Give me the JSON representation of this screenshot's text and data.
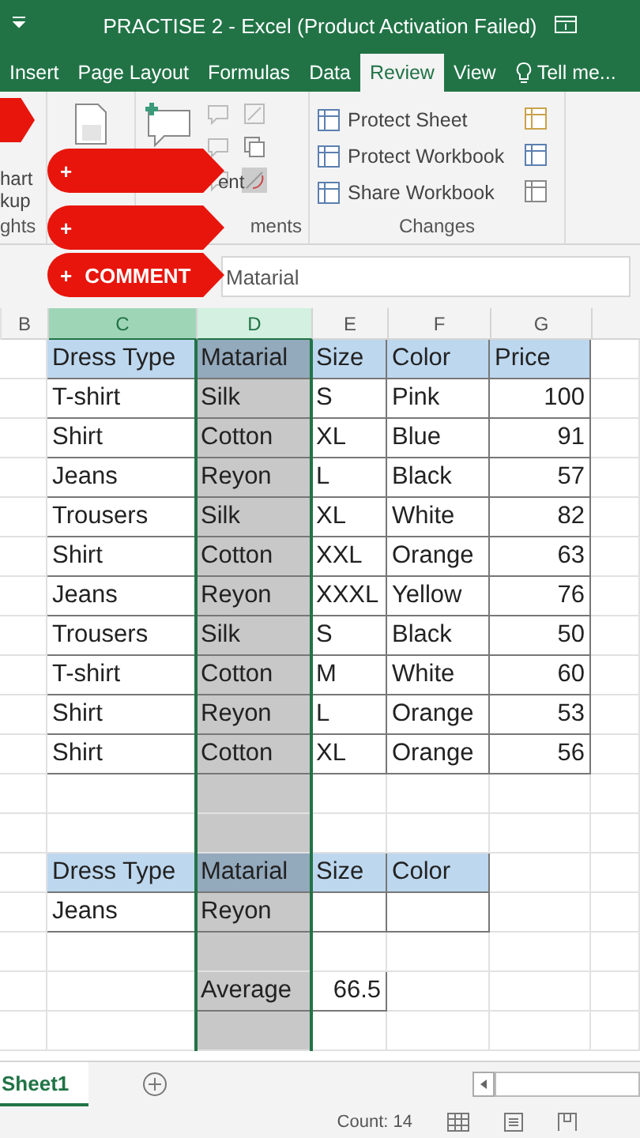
{
  "window": {
    "title": "PRACTISE 2 - Excel (Product Activation Failed)"
  },
  "ribbon_tabs": [
    {
      "label": "Insert",
      "selected": false
    },
    {
      "label": "Page Layout",
      "selected": false
    },
    {
      "label": "Formulas",
      "selected": false
    },
    {
      "label": "Data",
      "selected": false
    },
    {
      "label": "Review",
      "selected": true
    },
    {
      "label": "View",
      "selected": false
    },
    {
      "label": "Tell me...",
      "selected": false
    }
  ],
  "ribbon": {
    "insights_lines": [
      "hart",
      "kup"
    ],
    "insights_group": "ghts",
    "comment_label": "ent",
    "comments_group": "ments",
    "changes_items": [
      "Protect Sheet",
      "Protect Workbook",
      "Share Workbook"
    ],
    "changes_group": "Changes"
  },
  "comment_tags": [
    {
      "plus": "+"
    },
    {
      "plus": "+"
    },
    {
      "plus": "+",
      "label": "COMMENT"
    }
  ],
  "formula_bar": {
    "value": "Matarial"
  },
  "column_headers": [
    {
      "label": "B",
      "selected": false
    },
    {
      "label": "C",
      "selected": true
    },
    {
      "label": "D",
      "selected": true
    },
    {
      "label": "E",
      "selected": false
    },
    {
      "label": "F",
      "selected": false
    },
    {
      "label": "G",
      "selected": false
    }
  ],
  "table": {
    "columns": [
      "Dress Type",
      "Matarial",
      "Size",
      "Color",
      "Price"
    ],
    "rows": [
      [
        "T-shirt",
        "Silk",
        "S",
        "Pink",
        "100"
      ],
      [
        "Shirt",
        "Cotton",
        "XL",
        "Blue",
        "91"
      ],
      [
        "Jeans",
        "Reyon",
        "L",
        "Black",
        "57"
      ],
      [
        "Trousers",
        "Silk",
        "XL",
        "White",
        "82"
      ],
      [
        "Shirt",
        "Cotton",
        "XXL",
        "Orange",
        "63"
      ],
      [
        "Jeans",
        "Reyon",
        "XXXL",
        "Yellow",
        "76"
      ],
      [
        "Trousers",
        "Silk",
        "S",
        "Black",
        "50"
      ],
      [
        "T-shirt",
        "Cotton",
        "M",
        "White",
        "60"
      ],
      [
        "Shirt",
        "Reyon",
        "L",
        "Orange",
        "53"
      ],
      [
        "Shirt",
        "Cotton",
        "XL",
        "Orange",
        "56"
      ]
    ]
  },
  "criteria": {
    "columns": [
      "Dress Type",
      "Matarial",
      "Size",
      "Color"
    ],
    "row": [
      "Jeans",
      "Reyon"
    ]
  },
  "average": {
    "label": "Average",
    "value": "66.5"
  },
  "sheet_tabs": [
    {
      "label": "Sheet1",
      "selected": true
    }
  ],
  "status_bar": {
    "text": "Count: 14"
  }
}
